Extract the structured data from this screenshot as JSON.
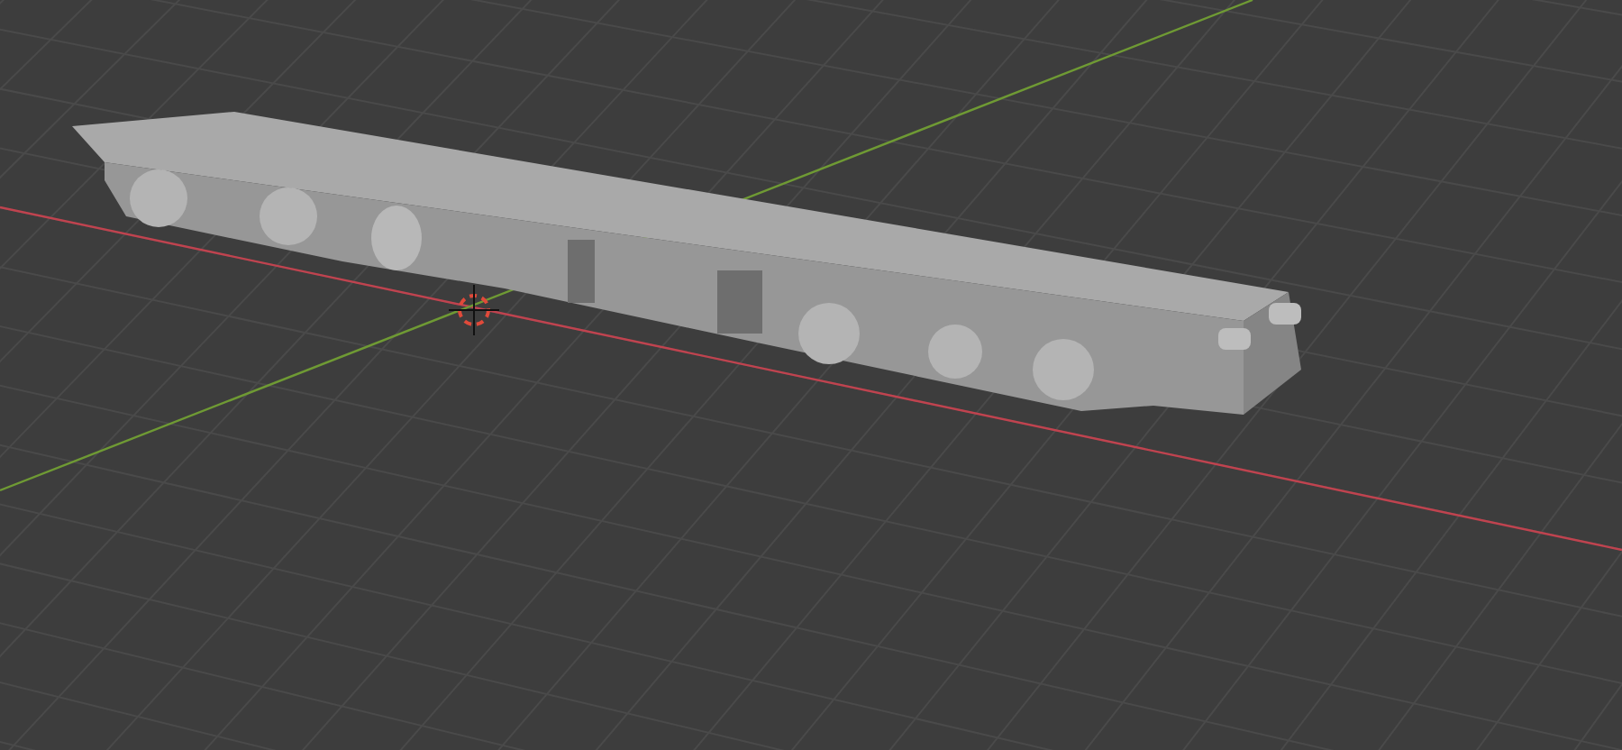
{
  "viewport": {
    "axes": [
      {
        "kind": "x",
        "color": "#c0434f"
      },
      {
        "kind": "y",
        "color": "#6f9a34"
      }
    ],
    "show_cursor": true
  }
}
